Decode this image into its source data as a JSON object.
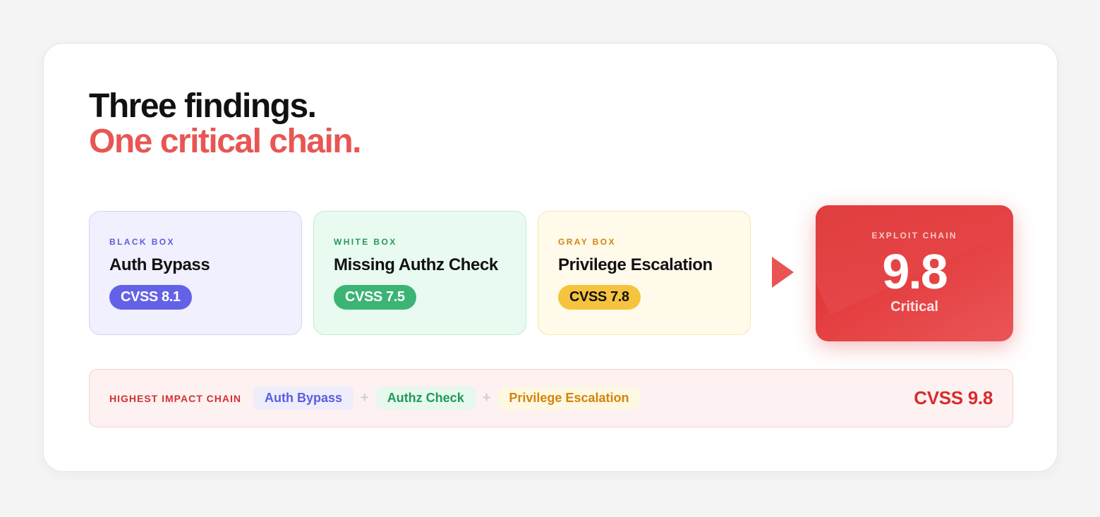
{
  "headline": {
    "line1": "Three findings.",
    "line2": "One critical chain."
  },
  "findings": [
    {
      "label": "BLACK BOX",
      "title": "Auth Bypass",
      "badge": "CVSS 8.1",
      "accent": "#6362e7"
    },
    {
      "label": "WHITE BOX",
      "title": "Missing Authz Check",
      "badge": "CVSS 7.5",
      "accent": "#3bb474"
    },
    {
      "label": "GRAY BOX",
      "title": "Privilege Escalation",
      "badge": "CVSS 7.8",
      "accent": "#f6c33e"
    }
  ],
  "exploit": {
    "label": "EXPLOIT CHAIN",
    "score": "9.8",
    "severity": "Critical",
    "color": "#e43d3f"
  },
  "chain": {
    "label": "HIGHEST IMPACT CHAIN",
    "steps": [
      "Auth Bypass",
      "Authz Check",
      "Privilege Escalation"
    ],
    "separator": "+",
    "score": "CVSS 9.8"
  }
}
